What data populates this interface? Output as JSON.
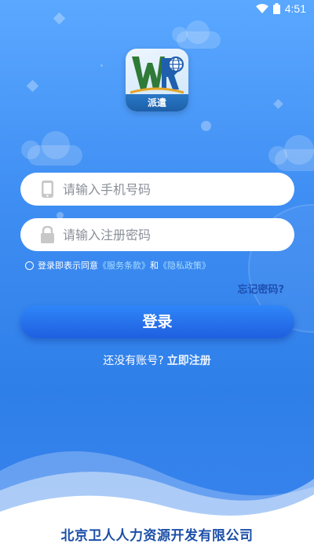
{
  "status_bar": {
    "time": "4:51",
    "icons": [
      "wifi-icon",
      "battery-icon"
    ]
  },
  "logo": {
    "caption": "派遣",
    "letters": "WR"
  },
  "form": {
    "phone_placeholder": "请输入手机号码",
    "password_placeholder": "请输入注册密码"
  },
  "agreement": {
    "prefix": "登录即表示同意",
    "terms": "《服务条款》",
    "and": "和",
    "privacy": "《隐私政策》",
    "checked": false
  },
  "forgot_password": "忘记密码?",
  "login_button": "登录",
  "register": {
    "prompt": "还没有账号?",
    "link": "立即注册"
  },
  "footer": {
    "company": "北京卫人人力资源开发有限公司"
  },
  "colors": {
    "primary": "#2f7fe9",
    "button": "#1f5fe0",
    "company": "#1c4fa8"
  }
}
